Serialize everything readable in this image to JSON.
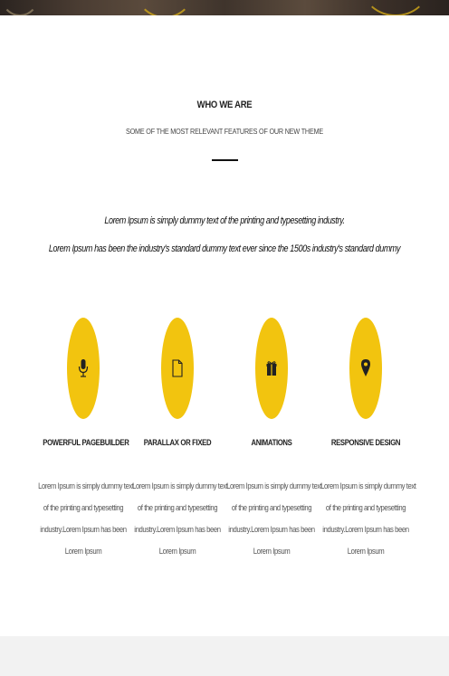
{
  "section": {
    "title": "WHO WE ARE",
    "subtitle": "SOME OF THE MOST RELEVANT FEATURES OF OUR NEW THEME",
    "intro_line_1": "Lorem Ipsum is simply dummy text of the printing and typesetting industry.",
    "intro_line_2": "Lorem Ipsum has been the industry's standard dummy text ever since the 1500s industry's standard dummy"
  },
  "colors": {
    "accent": "#f2c40f",
    "heading": "#222222",
    "body_text": "#555555",
    "footer_band": "#f2f2f2"
  },
  "features": [
    {
      "icon": "microphone-icon",
      "title": "POWERFUL PAGEBUILDER",
      "desc_lines": [
        "Lorem Ipsum is simply dummy text",
        "of the printing and typesetting",
        "industry.Lorem Ipsum has been",
        "Lorem Ipsum"
      ]
    },
    {
      "icon": "document-icon",
      "title": "PARALLAX OR FIXED",
      "desc_lines": [
        "Lorem Ipsum is simply dummy text",
        "of the printing and typesetting",
        "industry.Lorem Ipsum has been",
        "Lorem Ipsum"
      ]
    },
    {
      "icon": "gift-icon",
      "title": "ANIMATIONS",
      "desc_lines": [
        "Lorem Ipsum is simply dummy text",
        "of the printing and typesetting",
        "industry.Lorem Ipsum has been",
        "Lorem Ipsum"
      ]
    },
    {
      "icon": "map-pin-icon",
      "title": "RESPONSIVE DESIGN",
      "desc_lines": [
        "Lorem Ipsum is simply dummy text",
        "of the printing and typesetting",
        "industry.Lorem Ipsum has been",
        "Lorem Ipsum"
      ]
    }
  ]
}
